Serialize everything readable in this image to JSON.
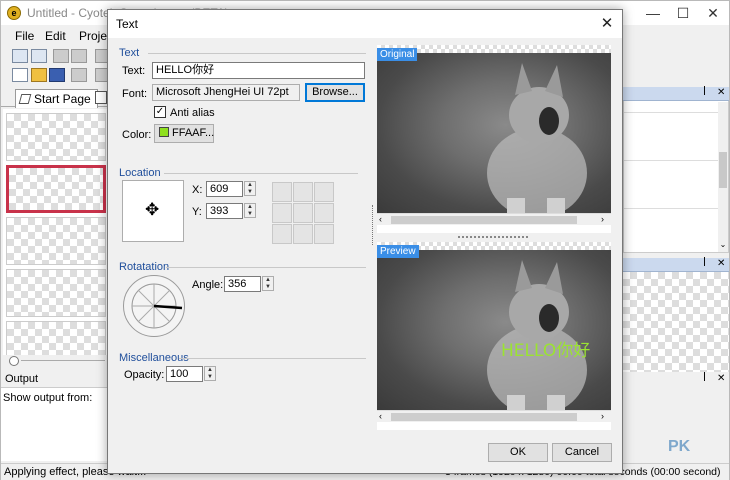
{
  "app": {
    "title": "Untitled - Cyotek G…animator (BETA)",
    "menu": [
      "File",
      "Edit",
      "Proje"
    ],
    "start_tab": "Start Page",
    "output_title": "Output",
    "output_label": "Show output from:",
    "status_left": "Applying effect, please wait...",
    "status_right": "3 frames (1920 x 1280)  00:00 total seconds (00:00 second)",
    "watermark": "PK"
  },
  "dialog": {
    "title": "Text",
    "sections": {
      "text": "Text",
      "location": "Location",
      "rotation": "Rotatation",
      "misc": "Miscellaneous"
    },
    "text_label": "Text:",
    "text_value": "HELLO你好",
    "font_label": "Font:",
    "font_value": "Microsoft JhengHei UI 72pt",
    "browse_label": "Browse...",
    "antialias_label": "Anti alias",
    "antialias_checked": true,
    "color_label": "Color:",
    "color_value": "FFAAF...",
    "color_swatch": "#8fe01e",
    "x_label": "X:",
    "x_value": "609",
    "y_label": "Y:",
    "y_value": "393",
    "angle_label": "Angle:",
    "angle_value": "356",
    "opacity_label": "Opacity:",
    "opacity_value": "100",
    "original_label": "Original",
    "preview_label": "Preview",
    "overlay_text": "HELLO你好",
    "ok_label": "OK",
    "cancel_label": "Cancel"
  }
}
